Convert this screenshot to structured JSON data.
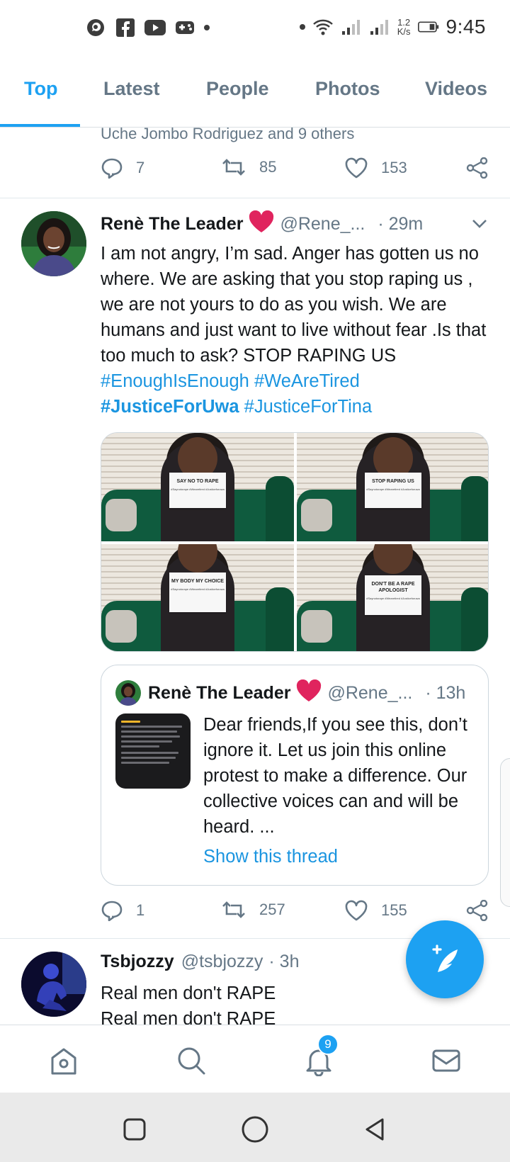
{
  "status_bar": {
    "speed_value": "1.2",
    "speed_unit": "K/s",
    "time": "9:45"
  },
  "tabs": [
    {
      "label": "Top",
      "active": true
    },
    {
      "label": "Latest",
      "active": false
    },
    {
      "label": "People",
      "active": false
    },
    {
      "label": "Photos",
      "active": false
    },
    {
      "label": "Videos",
      "active": false
    }
  ],
  "tweet_prev": {
    "retweeted_by": "Uche Jombo Rodriguez and 9 others",
    "replies": "7",
    "retweets": "85",
    "likes": "153"
  },
  "tweet_main": {
    "name": "Renè The Leader",
    "handle": "@Rene_...",
    "time": "· 29m",
    "text": "I am not angry, I’m sad. Anger has gotten us no where. We are asking that you stop raping us , we are not yours to do as you wish. We are humans and just want to live without fear .Is that too much to ask? STOP RAPING US ",
    "hashtags": [
      "#EnoughIsEnough",
      "#WeAreTired",
      "#JusticeForUwa",
      "#JusticeForTina"
    ],
    "photos": [
      {
        "sign": "SAY NO TO RAPE",
        "tags": "#Saynotorape #Wearetired #Justiceforuwa"
      },
      {
        "sign": "STOP RAPING US",
        "tags": "#Saynotorape #Wearetired #Justiceforuwa"
      },
      {
        "sign": "MY BODY MY CHOICE",
        "tags": "#Saynotorape #Wearetired #Justiceforuwa"
      },
      {
        "sign": "DON'T BE A RAPE APOLOGIST",
        "tags": "#Saynotorape #Wearetired #Justiceforuwa"
      }
    ],
    "quote": {
      "name": "Renè The Leader",
      "handle": "@Rene_...",
      "time": "· 13h",
      "text": "Dear friends,If you see this, don’t ignore it. Let us join this online protest to make a difference. Our collective voices can and will be heard. ...",
      "show_thread": "Show this thread"
    },
    "replies": "1",
    "retweets": "257",
    "likes": "155"
  },
  "tweet_next": {
    "name": "Tsbjozzy",
    "handle": "@tsbjozzy",
    "time": "· 3h",
    "line1": "Real men don't RAPE",
    "line2": "Real men don't RAPE"
  },
  "bottom_nav": {
    "notifications_badge": "9"
  },
  "colors": {
    "accent": "#1da1f2",
    "heart": "#e0245e",
    "muted": "#657786"
  }
}
